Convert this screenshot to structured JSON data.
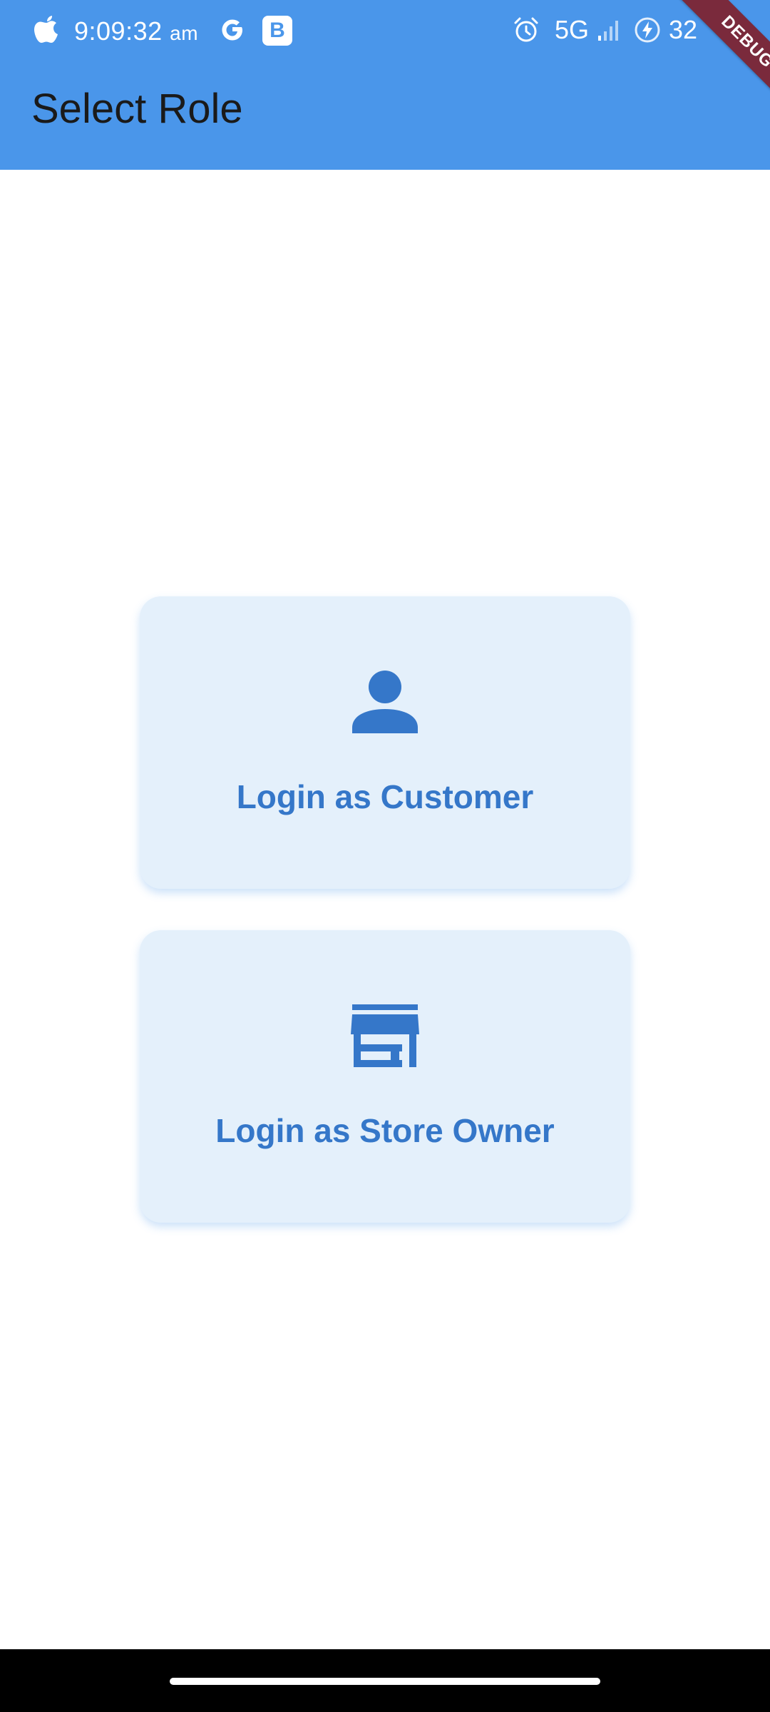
{
  "status_bar": {
    "time": "9:09:32",
    "time_suffix": "am",
    "notification_badge": "B",
    "network": "5G",
    "battery": "32"
  },
  "app_bar": {
    "title": "Select Role"
  },
  "debug_banner": "DEBUG",
  "roles": [
    {
      "label": "Login as Customer",
      "icon": "person-icon"
    },
    {
      "label": "Login as Store Owner",
      "icon": "storefront-icon"
    }
  ],
  "colors": {
    "app_bar": "#4a96ea",
    "card_background": "#e4f0fb",
    "accent": "#3577c9",
    "debug_banner": "#7a2a3c"
  }
}
